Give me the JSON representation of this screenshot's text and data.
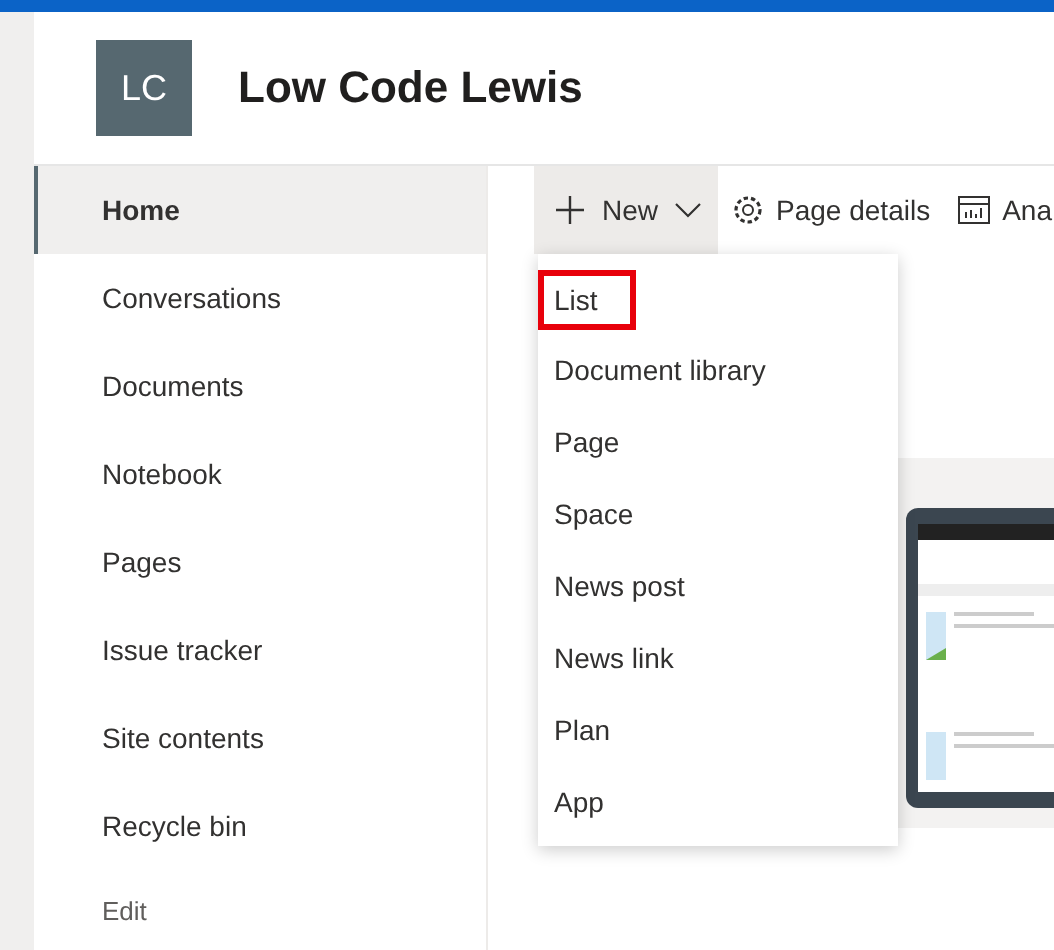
{
  "site": {
    "logo": "LC",
    "title": "Low Code Lewis"
  },
  "nav": {
    "items": [
      {
        "label": "Home",
        "selected": true
      },
      {
        "label": "Conversations",
        "selected": false
      },
      {
        "label": "Documents",
        "selected": false
      },
      {
        "label": "Notebook",
        "selected": false
      },
      {
        "label": "Pages",
        "selected": false
      },
      {
        "label": "Issue tracker",
        "selected": false
      },
      {
        "label": "Site contents",
        "selected": false
      },
      {
        "label": "Recycle bin",
        "selected": false
      }
    ],
    "edit": "Edit"
  },
  "command_bar": {
    "new": {
      "label": "New",
      "expanded": true
    },
    "page_details": "Page details",
    "analytics": "Ana"
  },
  "new_menu": [
    {
      "label": "List",
      "highlighted": true
    },
    {
      "label": "Document library",
      "highlighted": false
    },
    {
      "label": "Page",
      "highlighted": false
    },
    {
      "label": "Space",
      "highlighted": false
    },
    {
      "label": "News post",
      "highlighted": false
    },
    {
      "label": "News link",
      "highlighted": false
    },
    {
      "label": "Plan",
      "highlighted": false
    },
    {
      "label": "App",
      "highlighted": false
    }
  ]
}
